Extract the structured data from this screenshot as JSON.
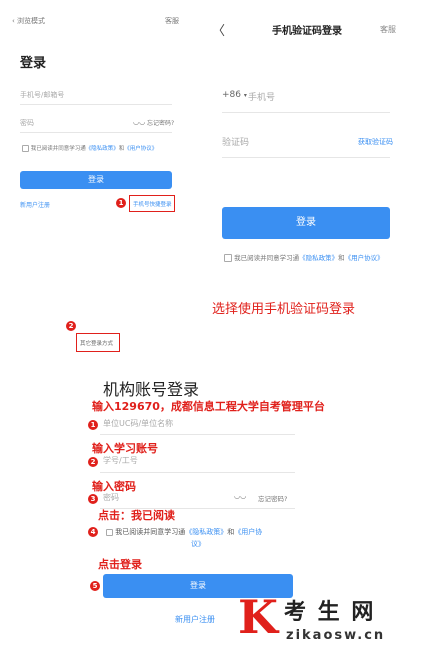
{
  "screen1": {
    "back_label": "浏览模式",
    "service_label": "客服",
    "title": "登录",
    "account_placeholder": "手机号/邮箱号",
    "password_placeholder": "密码",
    "forgot_label": "忘记密码?",
    "agreement_prefix": "我已阅读并同意学习通",
    "privacy_link": "《隐私政策》",
    "and_text": "和",
    "user_link": "《用户协议》",
    "login_button": "登录",
    "register_link": "新用户注册",
    "sms_login_link": "手机号快捷登录",
    "other_login": "其它登录方式"
  },
  "screen2": {
    "back_glyph": "〈",
    "title": "手机验证码登录",
    "service_label": "客服",
    "country_code": "+86",
    "phone_placeholder": "手机号",
    "code_placeholder": "验证码",
    "get_code_label": "获取验证码",
    "login_button": "登录",
    "agreement_prefix": "我已阅读并同意学习通",
    "privacy_link": "《隐私政策》",
    "and_text": "和",
    "user_link": "《用户协议》"
  },
  "screen3": {
    "title": "机构账号登录",
    "unit_placeholder": "单位UC码/单位名称",
    "id_placeholder": "学号/工号",
    "password_placeholder": "密码",
    "forgot_label": "忘记密码?",
    "agreement_prefix": "我已阅读并同意学习通",
    "privacy_link": "《隐私政策》",
    "and_text": "和",
    "user_link_part1": "《用户协",
    "user_link_part2": "议》",
    "login_button": "登录",
    "register_link": "新用户注册"
  },
  "annotations": {
    "step_1": "1",
    "step_2": "2",
    "step_3": "3",
    "step_4": "4",
    "step_5": "5",
    "choose_sms": "选择使用手机验证码登录",
    "enter_code": "输入129670，成都信息工程大学自考管理平台",
    "enter_account": "输入学习账号",
    "enter_password": "输入密码",
    "click_agree": "点击：我已阅读",
    "click_login": "点击登录"
  },
  "watermark": {
    "logo_letter": "K",
    "name": "考 生 网",
    "url": "zikaosw.cn"
  },
  "colors": {
    "accent": "#3a8ff2",
    "annotation": "#e0201b"
  }
}
